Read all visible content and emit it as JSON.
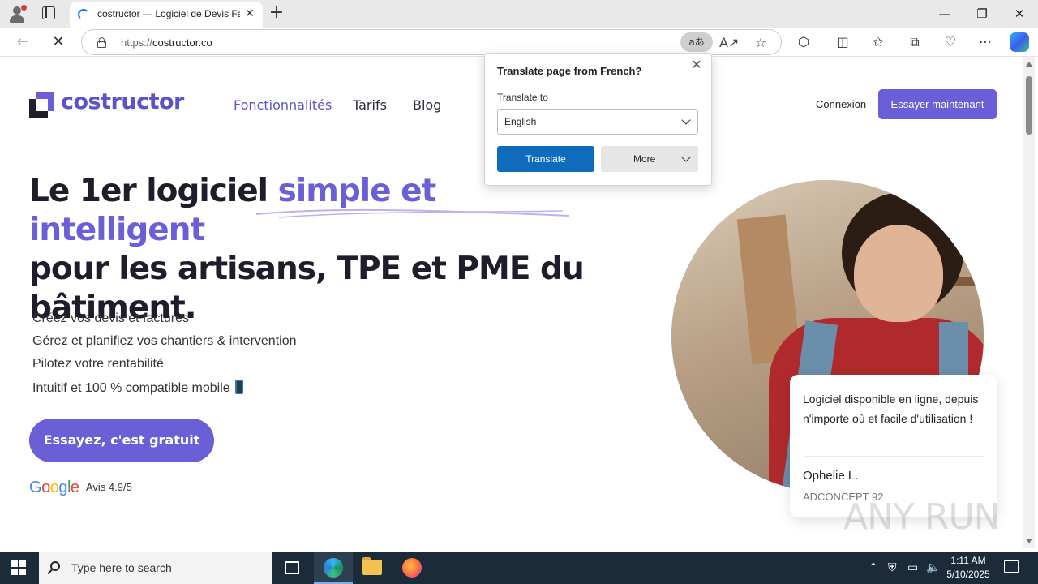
{
  "browser": {
    "tab_title": "costructor — Logiciel de Devis Fa",
    "url_scheme": "https://",
    "url_host": "costructor.co",
    "translate_icon_label": "aあ"
  },
  "site": {
    "logo_text": "costructor",
    "nav": [
      "Fonctionnalités",
      "Tarifs",
      "Blog"
    ],
    "login_label": "Connexion",
    "cta_top_label": "Essayer maintenant",
    "hero": {
      "title_before": "Le 1er logiciel ",
      "title_accent": "simple et intelligent",
      "title_after": "pour les artisans, TPE et PME du bâtiment."
    },
    "features": [
      "Créez vos devis et factures",
      "Gérez et planifiez vos chantiers & intervention",
      "Pilotez votre rentabilité",
      "Intuitif et 100 % compatible mobile"
    ],
    "cta_main_label": "Essayez, c'est gratuit",
    "google_letters": [
      "G",
      "o",
      "o",
      "g",
      "l",
      "e"
    ],
    "rating": "Avis 4.9/5",
    "testimonial": {
      "quote": "Logiciel disponible en ligne, depuis n'importe où et facile d'utilisation !",
      "author": "Ophelie L.",
      "company": "ADCONCEPT 92"
    },
    "watermark": "ANY RUN"
  },
  "translate_popup": {
    "title": "Translate page from French?",
    "target_label": "Translate to",
    "target_value": "English",
    "translate_button": "Translate",
    "more_button": "More"
  },
  "taskbar": {
    "search_placeholder": "Type here to search",
    "time": "1:11 AM",
    "date": "5/10/2025"
  },
  "colors": {
    "brand": "#6a5fd6",
    "translate_button": "#0f6cbd",
    "taskbar": "#1c2b3a"
  }
}
